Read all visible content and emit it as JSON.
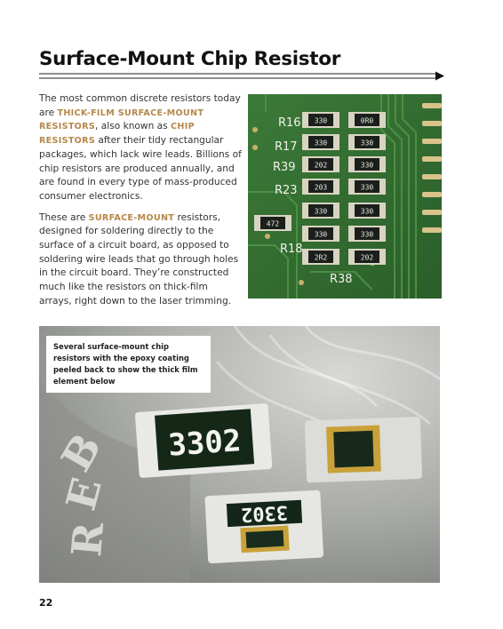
{
  "page": {
    "title": "Surface-Mount Chip Resistor",
    "page_number": "22"
  },
  "body": {
    "p1_a": "The most common discrete resistors today are ",
    "p1_hl1": "THICK-FILM SURFACE-MOUNT RESISTORS",
    "p1_b": ", also known as ",
    "p1_hl2": "CHIP RESISTORS",
    "p1_c": " after their tidy rectangular packages, which lack wire leads. Billions of chip resistors are produced annually, and are found in every type of mass-produced consumer electronics.",
    "p2_a": "These are ",
    "p2_hl": "SURFACE-MOUNT",
    "p2_b": " resistors, designed for soldering directly to the surface of a circuit board, as opposed to soldering wire leads that go through holes in the circuit board. They’re constructed much like the resistors on thick-film arrays, right down to the laser trimming."
  },
  "pcb_photo": {
    "silk_labels": [
      "R16",
      "R17",
      "R39",
      "R23",
      "R18",
      "R38"
    ],
    "chip_codes": [
      "330",
      "0R0",
      "330",
      "330",
      "202",
      "330",
      "203",
      "330",
      "330",
      "330",
      "472",
      "330",
      "330",
      "2R2",
      "202"
    ]
  },
  "closeup_photo": {
    "caption": "Several surface-mount chip resistors with the epoxy coating peeled back to show the thick film element below",
    "chip_code_1": "3302",
    "chip_code_2": "3302",
    "coin_letters": [
      "B",
      "E",
      "R"
    ]
  },
  "colors": {
    "accent": "#b5884a",
    "pcb_green": "#2f6b30",
    "title": "#111111"
  }
}
